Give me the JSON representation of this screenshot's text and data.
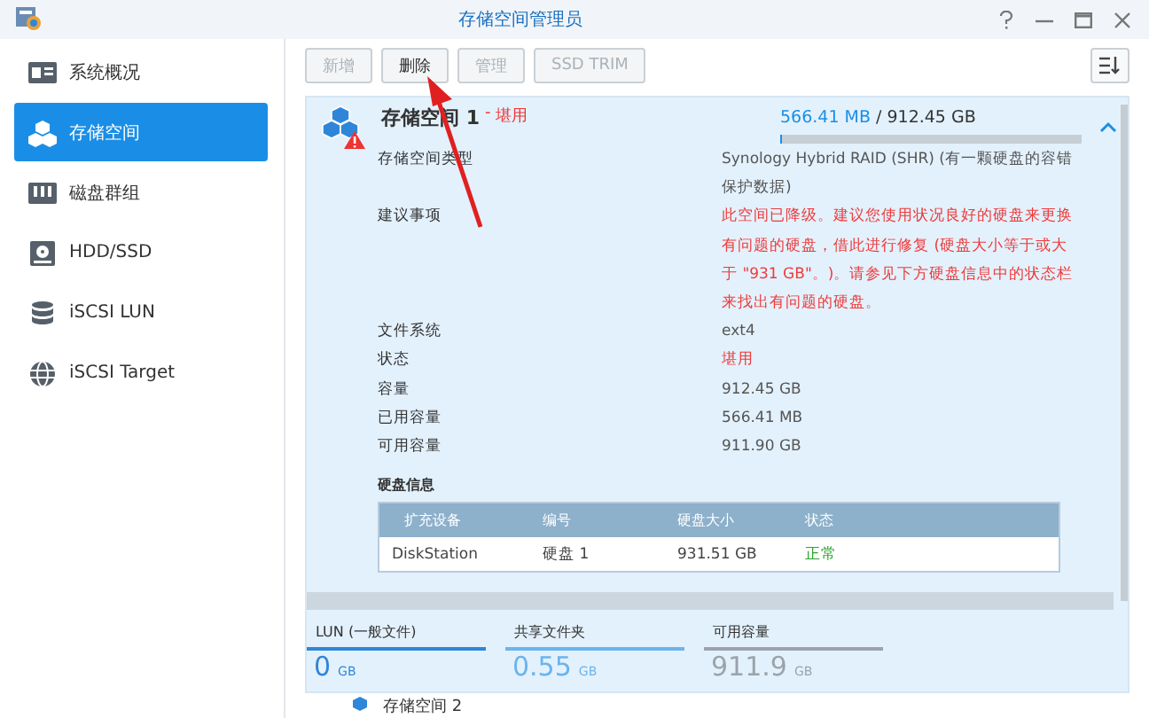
{
  "window": {
    "title": "存储空间管理员"
  },
  "sidebar": {
    "items": [
      {
        "label": "系统概况",
        "selected": false
      },
      {
        "label": "存储空间",
        "selected": true
      },
      {
        "label": "磁盘群组",
        "selected": false
      },
      {
        "label": "HDD/SSD",
        "selected": false
      },
      {
        "label": "iSCSI LUN",
        "selected": false
      },
      {
        "label": "iSCSI Target",
        "selected": false
      }
    ]
  },
  "toolbar": {
    "buttons": [
      {
        "label": "新增",
        "disabled": true
      },
      {
        "label": "删除",
        "disabled": false
      },
      {
        "label": "管理",
        "disabled": true
      },
      {
        "label": "SSD TRIM",
        "disabled": true
      }
    ]
  },
  "volume": {
    "name": "存储空间 1",
    "separator": "-",
    "status": "堪用",
    "used": "566.41 MB",
    "total": "/ 912.45 GB",
    "level": 0.002,
    "expanded": true,
    "details": [
      {
        "label": "存储空间类型",
        "value": "Synology Hybrid RAID (SHR) (有一颗硬盘的容错保护数据)",
        "warning": false
      },
      {
        "label": "建议事项",
        "value": "此空间已降级。建议您使用状况良好的硬盘来更换有问题的硬盘，借此进行修复 (硬盘大小等于或大于 \"931 GB\"。)。请参见下方硬盘信息中的状态栏来找出有问题的硬盘。",
        "warning": true
      },
      {
        "label": "文件系统",
        "value": "ext4",
        "warning": false
      },
      {
        "label": "状态",
        "value": "堪用",
        "warning": true
      },
      {
        "label": "容量",
        "value": "912.45 GB",
        "warning": false
      },
      {
        "label": "已用容量",
        "value": "566.41 MB",
        "warning": false
      },
      {
        "label": "可用容量",
        "value": "911.90 GB",
        "warning": false
      }
    ],
    "disk_info": {
      "title": "硬盘信息",
      "columns": [
        "扩充设备",
        "编号",
        "硬盘大小",
        "状态"
      ],
      "rows": [
        {
          "cells": [
            "DiskStation",
            "硬盘 1",
            "931.51 GB",
            "正常"
          ],
          "healthy": true
        }
      ]
    },
    "summary": [
      {
        "label": "LUN (一般文件)",
        "value": "0",
        "unit": "GB",
        "color": "#2f86d8"
      },
      {
        "label": "共享文件夹",
        "value": "0.55",
        "unit": "GB",
        "color": "#6ab4ee"
      },
      {
        "label": "可用容量",
        "value": "911.9",
        "unit": "GB",
        "color": "#9aa3ab"
      }
    ]
  },
  "next_volume": {
    "name": "存储空间 2"
  }
}
